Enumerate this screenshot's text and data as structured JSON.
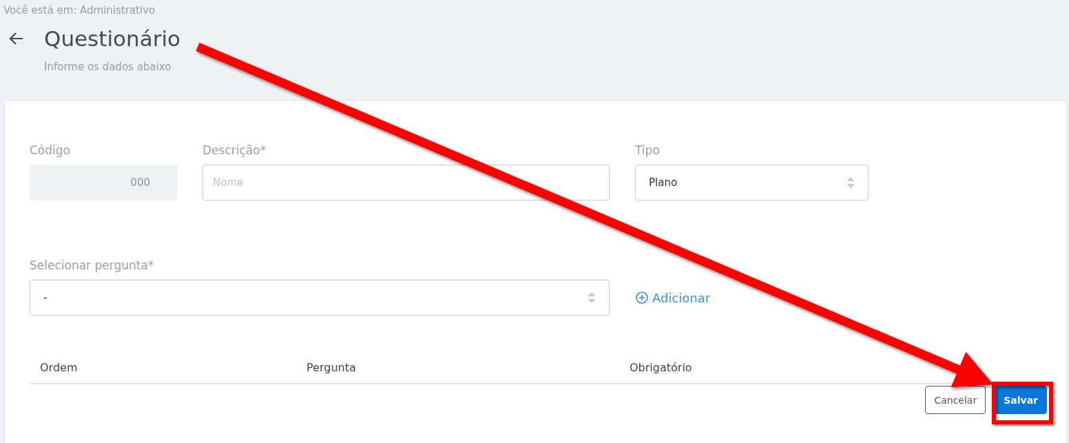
{
  "breadcrumb": "Você está em: Administrativo",
  "page": {
    "title": "Questionário",
    "subtitle": "Informe os dados abaixo"
  },
  "fields": [
    {
      "kind": "readonly",
      "label": "Código",
      "value": "000"
    },
    {
      "kind": "text",
      "label": "Descrição*",
      "placeholder": "Nome"
    },
    {
      "kind": "select",
      "label": "Tipo",
      "value": "Plano"
    }
  ],
  "question_select": {
    "label": "Selecionar pergunta*",
    "value": "-"
  },
  "add_link": "Adicionar",
  "table": {
    "columns": [
      "Ordem",
      "Pergunta",
      "Obrigatório"
    ]
  },
  "buttons": [
    {
      "kind": "secondary",
      "label": "Cancelar"
    },
    {
      "kind": "primary",
      "label": "Salvar"
    }
  ]
}
